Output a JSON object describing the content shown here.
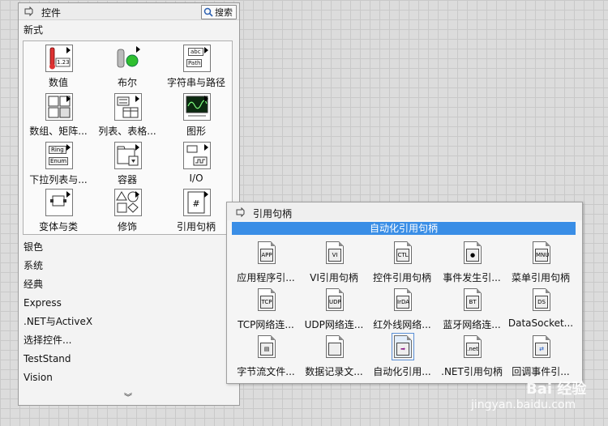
{
  "palette": {
    "title": "控件",
    "search_label": "搜索",
    "section": "新式",
    "tiles": [
      {
        "label": "数值"
      },
      {
        "label": "布尔"
      },
      {
        "label": "字符串与路径"
      },
      {
        "label": "数组、矩阵..."
      },
      {
        "label": "列表、表格..."
      },
      {
        "label": "图形"
      },
      {
        "label": "下拉列表与..."
      },
      {
        "label": "容器"
      },
      {
        "label": "I/O"
      },
      {
        "label": "变体与类"
      },
      {
        "label": "修饰"
      },
      {
        "label": "引用句柄"
      }
    ],
    "categories": [
      "银色",
      "系统",
      "经典",
      "Express",
      ".NET与ActiveX",
      "选择控件...",
      "TestStand",
      "Vision"
    ],
    "tile_icons": {
      "string": "abc",
      "path": "Path",
      "num": "1.23",
      "ring": "Ring",
      "enum": "Enum",
      "io": "⎍"
    }
  },
  "subpalette": {
    "title": "引用句柄",
    "header": "自动化引用句柄",
    "header_color": "#3a8ee6",
    "items": [
      {
        "label": "应用程序引...",
        "glyph": "APP"
      },
      {
        "label": "VI引用句柄",
        "glyph": "VI"
      },
      {
        "label": "控件引用句柄",
        "glyph": "CTL"
      },
      {
        "label": "事件发生引...",
        "glyph": "●"
      },
      {
        "label": "菜单引用句柄",
        "glyph": "MNU"
      },
      {
        "label": "TCP网络连...",
        "glyph": "TCP"
      },
      {
        "label": "UDP网络连...",
        "glyph": "UDP"
      },
      {
        "label": "红外线网络...",
        "glyph": "IrDA"
      },
      {
        "label": "蓝牙网络连...",
        "glyph": "BT"
      },
      {
        "label": "DataSocket...",
        "glyph": "DS"
      },
      {
        "label": "字节流文件...",
        "glyph": "▤"
      },
      {
        "label": "数据记录文...",
        "glyph": ""
      },
      {
        "label": "自动化引用...",
        "glyph": "➡"
      },
      {
        "label": ".NET引用句柄",
        "glyph": ".net"
      },
      {
        "label": "回调事件引...",
        "glyph": "⇄"
      }
    ]
  },
  "watermark": {
    "text": "jingyan.baidu.com",
    "logo": "Bai 经验"
  }
}
